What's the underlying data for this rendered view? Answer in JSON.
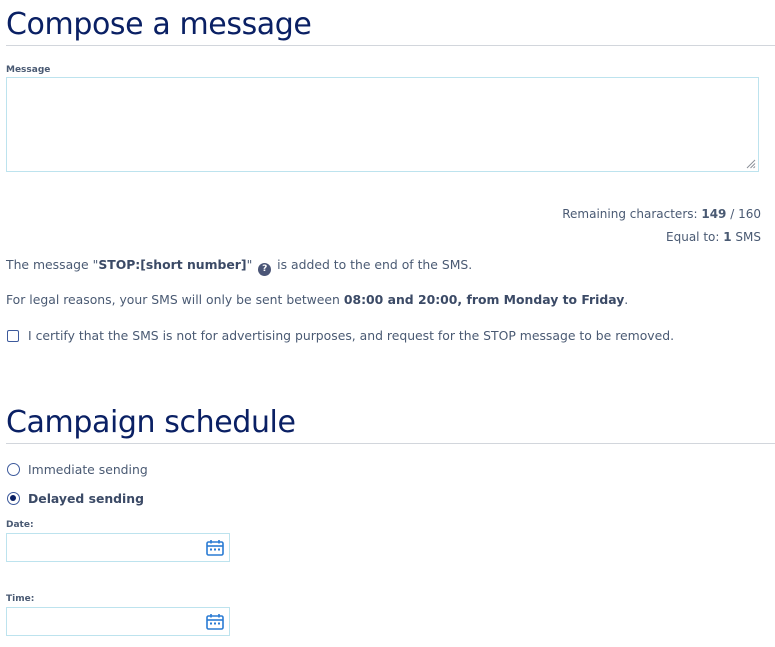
{
  "compose": {
    "title": "Compose a message",
    "message_label": "Message",
    "message_value": "",
    "remaining_prefix": "Remaining characters: ",
    "remaining_count": "149",
    "remaining_suffix": " / 160",
    "equal_prefix": "Equal to: ",
    "equal_count": "1",
    "equal_suffix": " SMS",
    "stop_text_before": "The message \"",
    "stop_text_bold": "STOP:[short number]",
    "stop_text_quote": "\"",
    "stop_help_glyph": "?",
    "stop_text_after": " is added to the end of the SMS.",
    "legal_before": "For legal reasons, your SMS will only be sent between ",
    "legal_bold": "08:00 and 20:00, from Monday to Friday",
    "legal_after": ".",
    "certify_label": "I certify that the SMS is not for advertising purposes, and request for the STOP message to be removed.",
    "certify_checked": false
  },
  "schedule": {
    "title": "Campaign schedule",
    "immediate_label": "Immediate sending",
    "delayed_label": "Delayed sending",
    "selected": "Delayed sending",
    "date_label": "Date:",
    "date_value": "",
    "time_label": "Time:",
    "time_value": ""
  },
  "colors": {
    "heading": "#0a2064",
    "text": "#4a5a73",
    "field_border": "#bde3ee",
    "control_border": "#3d5a9c",
    "calendar_icon": "#2a7bd3"
  },
  "icons": {
    "help": "question-circle-icon",
    "calendar": "calendar-icon",
    "resize": "resize-grip-icon"
  }
}
